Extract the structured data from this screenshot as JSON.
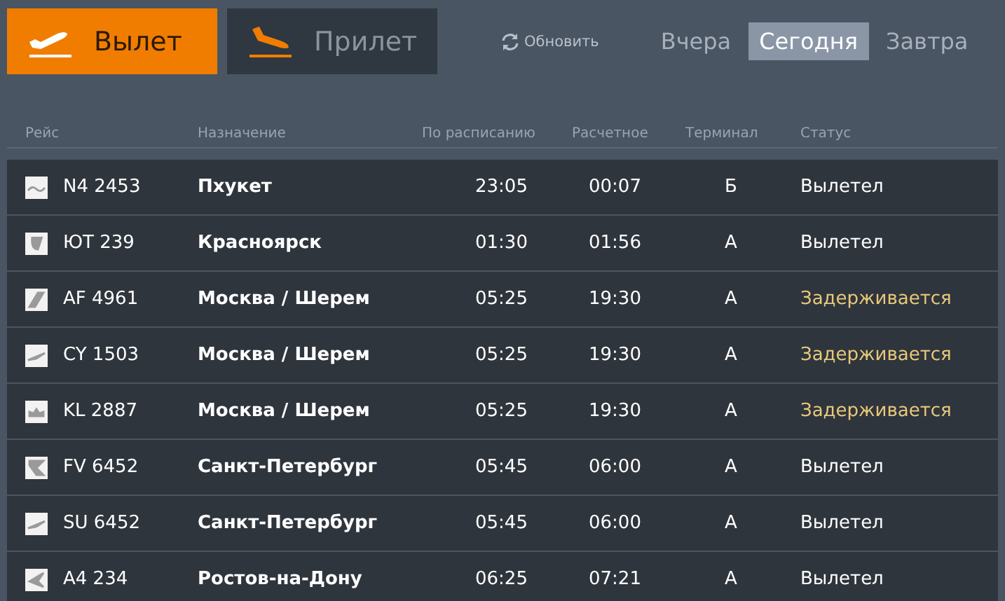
{
  "direction_tabs": [
    {
      "label": "Вылет",
      "selected": true,
      "kind": "departure"
    },
    {
      "label": "Прилет",
      "selected": false,
      "kind": "arrival"
    }
  ],
  "refresh": {
    "label": "Обновить"
  },
  "day_tabs": [
    {
      "label": "Вчера",
      "selected": false
    },
    {
      "label": "Сегодня",
      "selected": true
    },
    {
      "label": "Завтра",
      "selected": false
    }
  ],
  "table": {
    "columns": [
      "Рейс",
      "Назначение",
      "По расписанию",
      "Расчетное",
      "Терминал",
      "Статус"
    ],
    "rows": [
      {
        "flight": "N4 2453",
        "destination": "Пхукет",
        "scheduled": "23:05",
        "estimated": "00:07",
        "terminal": "Б",
        "status": "Вылетел",
        "delayed": false
      },
      {
        "flight": "ЮТ 239",
        "destination": "Красноярск",
        "scheduled": "01:30",
        "estimated": "01:56",
        "terminal": "А",
        "status": "Вылетел",
        "delayed": false
      },
      {
        "flight": "AF 4961",
        "destination": "Москва / Шерем",
        "scheduled": "05:25",
        "estimated": "19:30",
        "terminal": "А",
        "status": "Задерживается",
        "delayed": true
      },
      {
        "flight": "CY 1503",
        "destination": "Москва / Шерем",
        "scheduled": "05:25",
        "estimated": "19:30",
        "terminal": "А",
        "status": "Задерживается",
        "delayed": true
      },
      {
        "flight": "KL 2887",
        "destination": "Москва / Шерем",
        "scheduled": "05:25",
        "estimated": "19:30",
        "terminal": "А",
        "status": "Задерживается",
        "delayed": true
      },
      {
        "flight": "FV 6452",
        "destination": "Санкт-Петербург",
        "scheduled": "05:45",
        "estimated": "06:00",
        "terminal": "А",
        "status": "Вылетел",
        "delayed": false
      },
      {
        "flight": "SU 6452",
        "destination": "Санкт-Петербург",
        "scheduled": "05:45",
        "estimated": "06:00",
        "terminal": "А",
        "status": "Вылетел",
        "delayed": false
      },
      {
        "flight": "A4 234",
        "destination": "Ростов-на-Дону",
        "scheduled": "06:25",
        "estimated": "07:21",
        "terminal": "А",
        "status": "Вылетел",
        "delayed": false
      }
    ]
  }
}
